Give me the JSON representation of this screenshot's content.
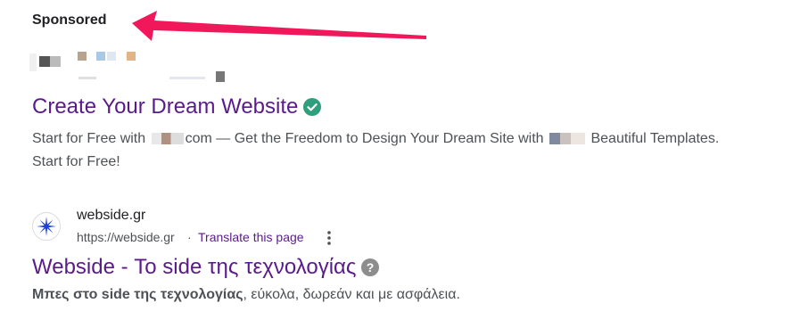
{
  "ad": {
    "sponsored_label": "Sponsored",
    "title": "Create Your Dream Website",
    "description_part1": "Start for Free with",
    "description_part2": "com — Get the Freedom to Design Your Dream Site with",
    "description_part3": "Beautiful Templates. Start for Free!",
    "verified_icon": "check-circle-icon"
  },
  "result": {
    "site_name": "webside.gr",
    "url": "https://webside.gr",
    "separator": "·",
    "translate_label": "Translate this page",
    "title": "Webside - Το side της τεχνολογίας",
    "snippet_bold": "Μπες στο side της τεχνολογίας",
    "snippet_rest": ", εύκολα, δωρεάν και με ασφάλεια."
  },
  "colors": {
    "link_visited": "#5a1a8c",
    "arrow": "#f0185a",
    "verified": "#2e9e7c",
    "text_secondary": "#4d5156"
  }
}
